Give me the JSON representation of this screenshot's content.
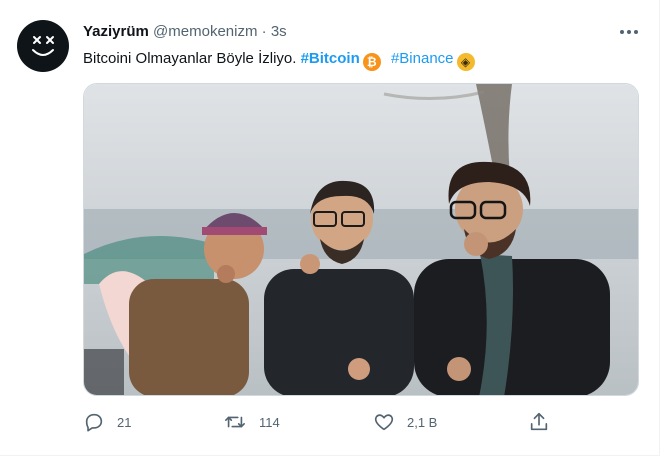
{
  "tweet": {
    "author": {
      "name": "Yaziyrüm",
      "handle": "@memokenizm",
      "separator": "·",
      "time": "3s"
    },
    "text": "Bitcoini Olmayanlar Böyle İzliyo.",
    "hashtags": [
      {
        "label": "#Bitcoin",
        "emoji": "bitcoin-emoji"
      },
      {
        "label": "#Binance",
        "emoji": "binance-emoji"
      }
    ],
    "media": {
      "description_icon": "photo",
      "people": 3
    },
    "actions": {
      "reply_count": "21",
      "retweet_count": "114",
      "like_count": "2,1 B"
    },
    "colors": {
      "accent": "#1d9bf0",
      "secondary_text": "#536471",
      "bitcoin": "#f7931a",
      "binance": "#f3ba2f"
    }
  }
}
